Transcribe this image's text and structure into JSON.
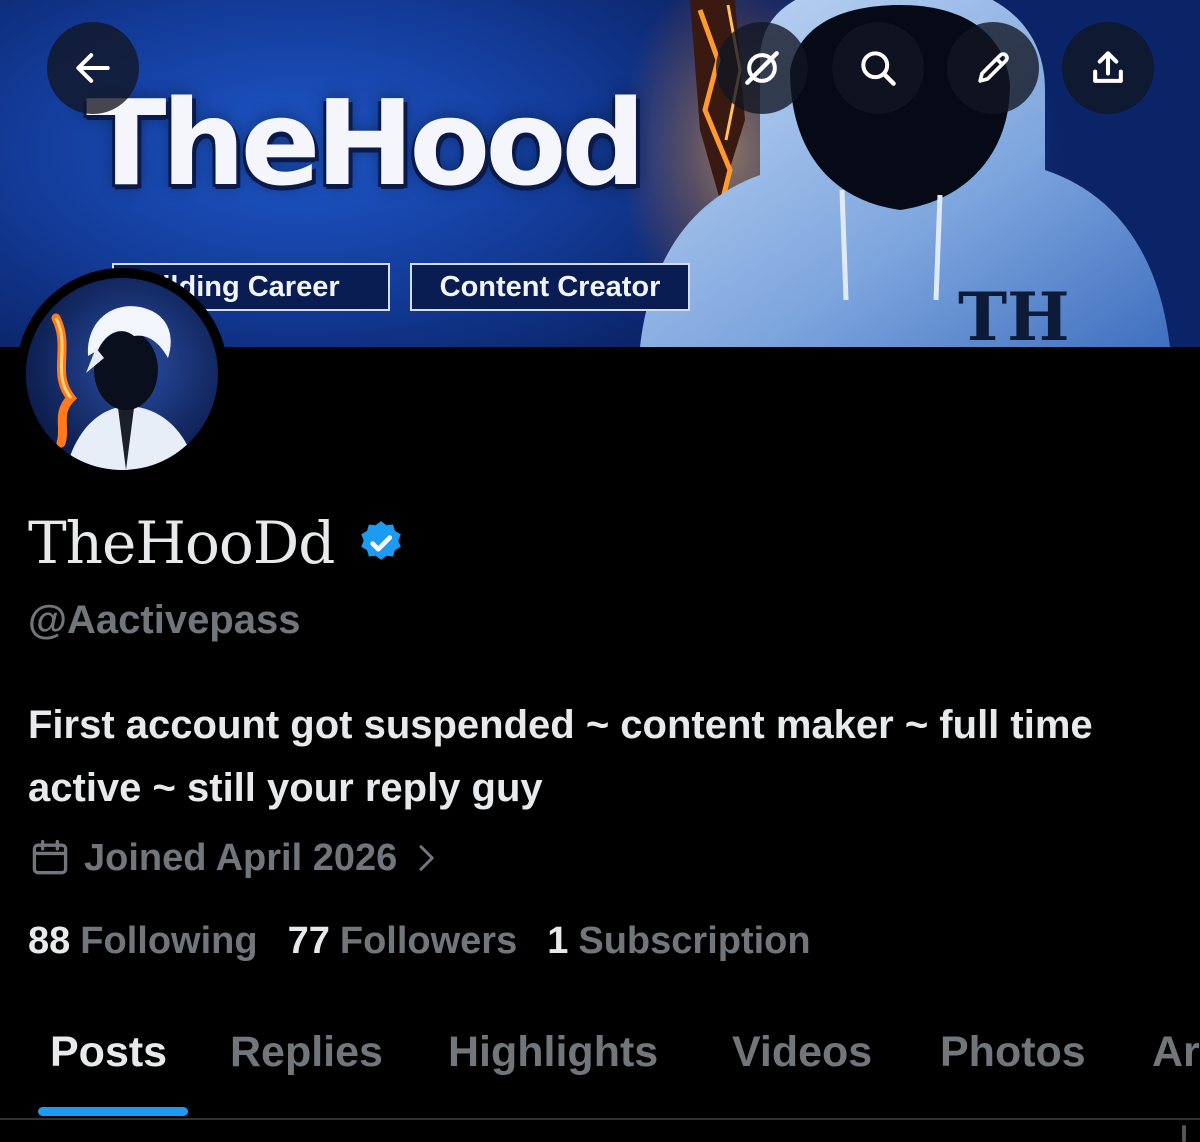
{
  "banner": {
    "title": "TheHood",
    "tags": [
      "ilding Career",
      "Content Creator"
    ],
    "hoodie_text": "TH",
    "colors": {
      "background": "#133c9a",
      "accent_fire": "#ff8a1c"
    }
  },
  "header": {
    "buttons": [
      {
        "name": "back-button",
        "icon": "arrow-left-icon"
      },
      {
        "name": "grok-button",
        "icon": "grok-icon"
      },
      {
        "name": "search-button",
        "icon": "search-icon"
      },
      {
        "name": "edit-button",
        "icon": "pencil-icon"
      },
      {
        "name": "share-button",
        "icon": "share-icon"
      }
    ]
  },
  "profile": {
    "display_name": "TheHooDd",
    "verified": true,
    "handle": "@Aactivepass",
    "bio": "First account got suspended ~ content maker ~ full time active ~ still your reply guy",
    "joined": "Joined April 2026",
    "stats": [
      {
        "count": "88",
        "label": "Following"
      },
      {
        "count": "77",
        "label": "Followers"
      },
      {
        "count": "1",
        "label": "Subscription"
      }
    ]
  },
  "tabs": {
    "items": [
      "Posts",
      "Replies",
      "Highlights",
      "Videos",
      "Photos",
      "Ar"
    ],
    "active": "Posts",
    "indicator_color": "#1d9bf0"
  },
  "colors": {
    "background": "#000000",
    "primary_text": "#e7e9ea",
    "secondary_text": "#71767b",
    "verified_badge": "#1d9bf0"
  }
}
